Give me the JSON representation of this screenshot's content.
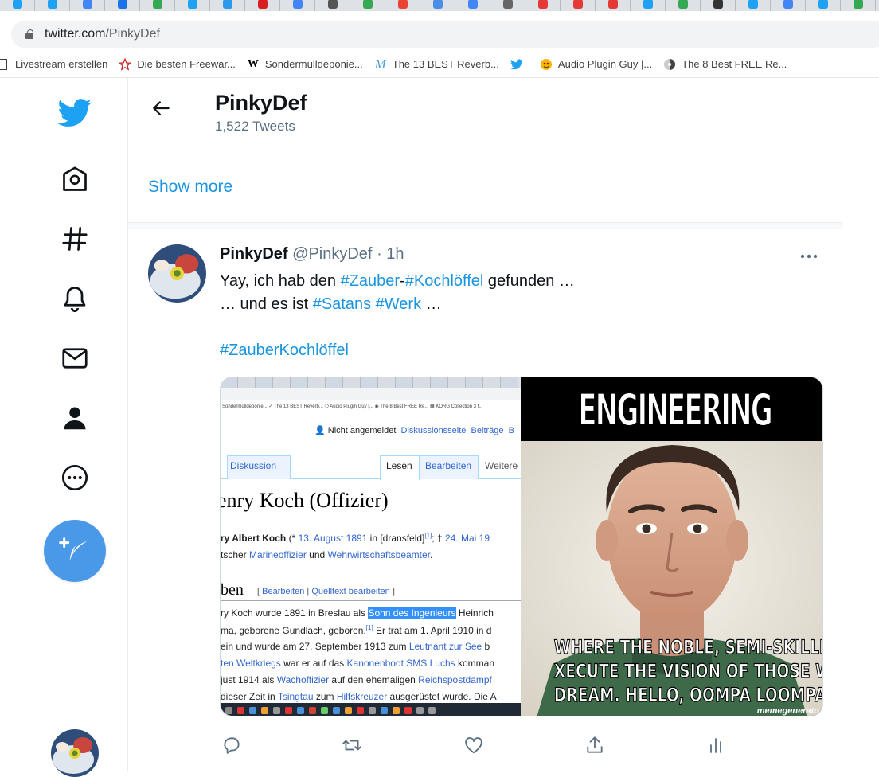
{
  "browser": {
    "url_host": "twitter.com",
    "url_path": "/PinkyDef",
    "bookmarks": [
      {
        "icon": "document-icon",
        "label": "Livestream erstellen"
      },
      {
        "icon": "star-icon",
        "label": "Die besten Freewar..."
      },
      {
        "icon": "wikipedia-icon",
        "label": "Sondermülldeponie..."
      },
      {
        "icon": "script-m-icon",
        "label": "The 13 BEST Reverb..."
      },
      {
        "icon": "twitter-bird-icon",
        "label": ""
      },
      {
        "icon": "plugin-guy-icon",
        "label": "Audio Plugin Guy |..."
      },
      {
        "icon": "disc-icon",
        "label": "The 8 Best FREE Re..."
      }
    ]
  },
  "profile": {
    "name": "PinkyDef",
    "tweet_count": "1,522 Tweets",
    "show_more": "Show more"
  },
  "tweet": {
    "name": "PinkyDef",
    "handle": "@PinkyDef",
    "dot": "·",
    "time": "1h",
    "line1_pre": "Yay, ich hab den ",
    "tag_zauber": "#Zauber",
    "dash": "-",
    "tag_kochloeffel": "#Kochlöffel",
    "line1_post": " gefunden …",
    "line2_pre": "… und es ist ",
    "tag_satans": "#Satans",
    "space": " ",
    "tag_werk": "#Werk",
    "line2_post": " …",
    "tag_line3": "#ZauberKochlöffel"
  },
  "wiki_screenshot": {
    "bookmarks": "Sondermülldeponie...   ✓ The 13 BEST Reverb...   ❍ Audio Plugin Guy |...   ◉ The 8 Best FREE Re...   ▦ KORG Collection 3 f...",
    "user_status": "Nicht angemeldet",
    "user_link1": "Diskussionsseite",
    "user_link2": "Beiträge",
    "user_link3": "B",
    "tab_discussion": "Diskussion",
    "tab_read": "Lesen",
    "tab_edit": "Bearbeiten",
    "tab_more": "Weitere",
    "title": "enry Koch (Offizier)",
    "intro_bold": "ry Albert Koch",
    "intro_1": " (* ",
    "intro_date1": "13. August 1891",
    "intro_2": " in [dransfeld]",
    "intro_ref": "[1]",
    "intro_3": "; † ",
    "intro_date2": "24. Mai 19",
    "intro2_1": "tscher ",
    "intro2_link1": "Marineoffizier",
    "intro2_2": " und ",
    "intro2_link2": "Wehrwirtschaftsbeamter",
    "intro2_3": ".",
    "section": "ben",
    "edit_open": "[ ",
    "edit_link1": "Bearbeiten",
    "edit_sep": " | ",
    "edit_link2": "Quelltext bearbeiten",
    "edit_close": " ]",
    "p1_a": "ry Koch wurde 1891 in Breslau als ",
    "p1_hl": "Sohn des Ingenieurs",
    "p1_b": " Heinrich",
    "p2_a": "ma, geborene Gundlach, geboren.",
    "p2_ref": "[1]",
    "p2_b": " Er trat am 1. April 1910 in d",
    "p3_a": "ein und wurde am 27. September 1913 zum ",
    "p3_link": "Leutnant zur See",
    "p3_b": " b",
    "p4_link1": "ten Weltkriegs",
    "p4_a": " war er auf das ",
    "p4_link2": "Kanonenboot SMS Luchs",
    "p4_b": " komman",
    "p5_a": "just 1914 als ",
    "p5_link1": "Wachoffizier",
    "p5_b": " auf den ehemaligen ",
    "p5_link2": "Reichspostdampf",
    "p6_a": "dieser Zeit in ",
    "p6_link1": "Tsingtau",
    "p6_b": " zum ",
    "p6_link2": "Hilfskreuzer",
    "p6_c": " ausgerüstet wurde. Die A"
  },
  "meme": {
    "title": "ENGINEERING",
    "caption1": "WHERE THE NOBLE, SEMI-SKILLED LABORERS",
    "caption2": "XECUTE THE VISION OF THOSE WHO THINK AN",
    "caption3": "DREAM. HELLO, OOMPA LOOMPAS OF SCIENCE",
    "credit": "memegenerato"
  },
  "colors": {
    "twitter_blue": "#1da1f2",
    "link_blue": "#1b95e0",
    "compose_blue": "#4a99e9",
    "secondary_text": "#5b7083"
  }
}
